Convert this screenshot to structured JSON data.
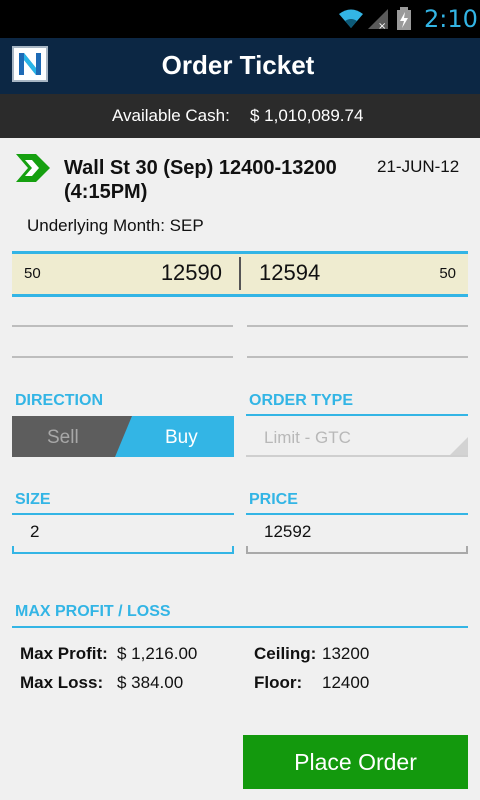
{
  "status_bar": {
    "time": "2:10",
    "icons": [
      "wifi-icon",
      "signal-icon",
      "battery-charging-icon"
    ]
  },
  "header": {
    "title": "Order Ticket",
    "logo_icon": "app-logo-n-icon"
  },
  "cash": {
    "label": "Available Cash:",
    "value": "$ 1,010,089.74"
  },
  "contract": {
    "icon": "green-arrow-icon",
    "name": "Wall St 30 (Sep) 12400-13200 (4:15PM)",
    "date": "21-JUN-12",
    "underlying_month": "Underlying Month: SEP"
  },
  "quote": {
    "bid_size": "50",
    "bid_price": "12590",
    "ask_price": "12594",
    "ask_size": "50"
  },
  "direction": {
    "label": "DIRECTION",
    "sell_label": "Sell",
    "buy_label": "Buy",
    "selected": "Buy"
  },
  "order_type": {
    "label": "ORDER TYPE",
    "value": "Limit - GTC"
  },
  "size": {
    "label": "SIZE",
    "value": "2"
  },
  "price": {
    "label": "PRICE",
    "value": "12592"
  },
  "profit_loss": {
    "label": "MAX PROFIT / LOSS",
    "max_profit_label": "Max Profit:",
    "max_profit_value": "$ 1,216.00",
    "max_loss_label": "Max Loss:",
    "max_loss_value": "$ 384.00",
    "ceiling_label": "Ceiling:",
    "ceiling_value": "13200",
    "floor_label": "Floor:",
    "floor_value": "12400"
  },
  "actions": {
    "place_order_label": "Place Order"
  },
  "colors": {
    "accent": "#33b5e5",
    "header_bg": "#0c2744",
    "cash_bar_bg": "#2b2b2b",
    "quote_bg": "#efecd0",
    "sell_bg": "#5d5d5d",
    "place_order_bg": "#13990d"
  }
}
